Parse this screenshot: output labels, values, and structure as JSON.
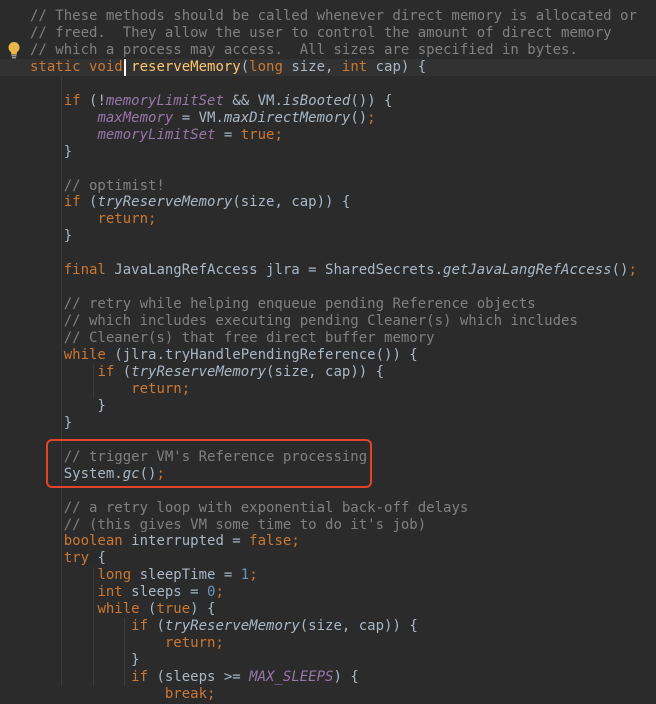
{
  "colors": {
    "background": "#2b2b2b",
    "current_line": "#323232",
    "comment": "#808080",
    "keyword": "#cc7832",
    "field": "#9876aa",
    "method_decl": "#ffc66d",
    "number": "#6897bb",
    "text": "#a9b7c6",
    "highlight_box": "#e2432a"
  },
  "icons": {
    "gutter": "lightbulb-icon"
  },
  "lines": [
    {
      "t": [
        [
          "c",
          "// These methods should be called whenever direct memory is allocated or"
        ]
      ]
    },
    {
      "t": [
        [
          "c",
          "// freed.  They allow the user to control the amount of direct memory"
        ]
      ]
    },
    {
      "t": [
        [
          "c",
          "// which a process may access.  All sizes are specified in bytes."
        ]
      ]
    },
    {
      "current": true,
      "t": [
        [
          "k",
          "static void "
        ],
        [
          "d",
          "reserveMemory"
        ],
        [
          "p",
          "("
        ],
        [
          "k",
          "long "
        ],
        [
          "p",
          "size, "
        ],
        [
          "k",
          "int "
        ],
        [
          "p",
          "cap) {"
        ]
      ]
    },
    {
      "t": []
    },
    {
      "t": [
        [
          "p",
          "    "
        ],
        [
          "k",
          "if "
        ],
        [
          "p",
          "(!"
        ],
        [
          "fi",
          "memoryLimitSet"
        ],
        [
          "p",
          " && VM."
        ],
        [
          "i",
          "isBooted"
        ],
        [
          "p",
          "()) {"
        ]
      ]
    },
    {
      "t": [
        [
          "p",
          "        "
        ],
        [
          "fi",
          "maxMemory"
        ],
        [
          "p",
          " = VM."
        ],
        [
          "i",
          "maxDirectMemory"
        ],
        [
          "p",
          "()"
        ],
        [
          "k",
          ";"
        ]
      ]
    },
    {
      "t": [
        [
          "p",
          "        "
        ],
        [
          "fi",
          "memoryLimitSet"
        ],
        [
          "p",
          " = "
        ],
        [
          "k",
          "true;"
        ]
      ]
    },
    {
      "t": [
        [
          "p",
          "    }"
        ]
      ]
    },
    {
      "t": []
    },
    {
      "t": [
        [
          "p",
          "    "
        ],
        [
          "c",
          "// optimist!"
        ]
      ]
    },
    {
      "t": [
        [
          "p",
          "    "
        ],
        [
          "k",
          "if "
        ],
        [
          "p",
          "("
        ],
        [
          "i",
          "tryReserveMemory"
        ],
        [
          "p",
          "(size, cap)) {"
        ]
      ]
    },
    {
      "t": [
        [
          "p",
          "        "
        ],
        [
          "k",
          "return;"
        ]
      ]
    },
    {
      "t": [
        [
          "p",
          "    }"
        ]
      ]
    },
    {
      "t": []
    },
    {
      "t": [
        [
          "p",
          "    "
        ],
        [
          "k",
          "final "
        ],
        [
          "p",
          "JavaLangRefAccess jlra = SharedSecrets."
        ],
        [
          "i",
          "getJavaLangRefAccess"
        ],
        [
          "p",
          "()"
        ],
        [
          "k",
          ";"
        ]
      ]
    },
    {
      "t": []
    },
    {
      "t": [
        [
          "p",
          "    "
        ],
        [
          "c",
          "// retry while helping enqueue pending Reference objects"
        ]
      ]
    },
    {
      "t": [
        [
          "p",
          "    "
        ],
        [
          "c",
          "// which includes executing pending Cleaner(s) which includes"
        ]
      ]
    },
    {
      "t": [
        [
          "p",
          "    "
        ],
        [
          "c",
          "// Cleaner(s) that free direct buffer memory"
        ]
      ]
    },
    {
      "t": [
        [
          "p",
          "    "
        ],
        [
          "k",
          "while "
        ],
        [
          "p",
          "(jlra.tryHandlePendingReference()) {"
        ]
      ]
    },
    {
      "t": [
        [
          "p",
          "        "
        ],
        [
          "k",
          "if "
        ],
        [
          "p",
          "("
        ],
        [
          "i",
          "tryReserveMemory"
        ],
        [
          "p",
          "(size, cap)) {"
        ]
      ]
    },
    {
      "t": [
        [
          "p",
          "            "
        ],
        [
          "k",
          "return;"
        ]
      ]
    },
    {
      "t": [
        [
          "p",
          "        }"
        ]
      ]
    },
    {
      "t": [
        [
          "p",
          "    }"
        ]
      ]
    },
    {
      "t": []
    },
    {
      "t": [
        [
          "p",
          "    "
        ],
        [
          "c",
          "// trigger VM's Reference processing"
        ]
      ]
    },
    {
      "t": [
        [
          "p",
          "    System."
        ],
        [
          "i",
          "gc"
        ],
        [
          "p",
          "()"
        ],
        [
          "k",
          ";"
        ]
      ]
    },
    {
      "t": []
    },
    {
      "t": [
        [
          "p",
          "    "
        ],
        [
          "c",
          "// a retry loop with exponential back-off delays"
        ]
      ]
    },
    {
      "t": [
        [
          "p",
          "    "
        ],
        [
          "c",
          "// (this gives VM some time to do it's job)"
        ]
      ]
    },
    {
      "t": [
        [
          "p",
          "    "
        ],
        [
          "k",
          "boolean "
        ],
        [
          "p",
          "interrupted = "
        ],
        [
          "k",
          "false;"
        ]
      ]
    },
    {
      "t": [
        [
          "p",
          "    "
        ],
        [
          "k",
          "try "
        ],
        [
          "p",
          "{"
        ]
      ]
    },
    {
      "t": [
        [
          "p",
          "        "
        ],
        [
          "k",
          "long "
        ],
        [
          "p",
          "sleepTime = "
        ],
        [
          "n",
          "1"
        ],
        [
          "k",
          ";"
        ]
      ]
    },
    {
      "t": [
        [
          "p",
          "        "
        ],
        [
          "k",
          "int "
        ],
        [
          "p",
          "sleeps = "
        ],
        [
          "n",
          "0"
        ],
        [
          "k",
          ";"
        ]
      ]
    },
    {
      "t": [
        [
          "p",
          "        "
        ],
        [
          "k",
          "while "
        ],
        [
          "p",
          "("
        ],
        [
          "k",
          "true"
        ],
        [
          "p",
          ") {"
        ]
      ]
    },
    {
      "t": [
        [
          "p",
          "            "
        ],
        [
          "k",
          "if "
        ],
        [
          "p",
          "("
        ],
        [
          "i",
          "tryReserveMemory"
        ],
        [
          "p",
          "(size, cap)) {"
        ]
      ]
    },
    {
      "t": [
        [
          "p",
          "                "
        ],
        [
          "k",
          "return;"
        ]
      ]
    },
    {
      "t": [
        [
          "p",
          "            }"
        ]
      ]
    },
    {
      "t": [
        [
          "p",
          "            "
        ],
        [
          "k",
          "if "
        ],
        [
          "p",
          "(sleeps >= "
        ],
        [
          "fi",
          "MAX_SLEEPS"
        ],
        [
          "p",
          ") {"
        ]
      ]
    },
    {
      "t": [
        [
          "p",
          "                "
        ],
        [
          "k",
          "break;"
        ]
      ]
    }
  ]
}
